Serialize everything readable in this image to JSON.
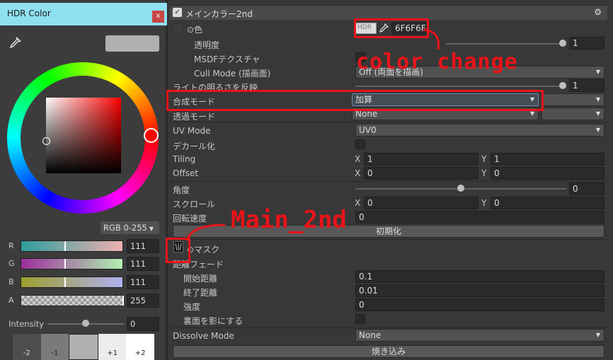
{
  "hdr_window": {
    "title": "HDR Color",
    "close_label": "x",
    "color_mode": "RGB 0-255",
    "channels": [
      {
        "label": "R",
        "value": "111",
        "fraction": 0.435
      },
      {
        "label": "G",
        "value": "111",
        "fraction": 0.435
      },
      {
        "label": "B",
        "value": "111",
        "fraction": 0.435
      },
      {
        "label": "A",
        "value": "255",
        "fraction": 1.0
      }
    ],
    "intensity_label": "Intensity",
    "intensity_value": "0",
    "presets": [
      "-2",
      "-1",
      "",
      "+1",
      "+2"
    ]
  },
  "inspector": {
    "section_title": "メインカラー2nd",
    "color_label": "色",
    "hdr_tag": "HDR",
    "hex_value": "6F6F6F",
    "transparency_label": "透明度",
    "transparency_value": "1",
    "msdf_label": "MSDFテクスチャ",
    "cull_label": "Cull Mode (描画面)",
    "cull_value": "Off (両面を描画)",
    "light_label": "ライトの明るさを反映",
    "light_value": "1",
    "blend_label": "合成モード",
    "blend_value": "加算",
    "trans_mode_label": "透過モード",
    "trans_mode_value": "None",
    "uv_label": "UV Mode",
    "uv_value": "UV0",
    "decal_label": "デカール化",
    "tiling_label": "Tiling",
    "tiling_x": "1",
    "tiling_y": "1",
    "offset_label": "Offset",
    "offset_x": "0",
    "offset_y": "0",
    "angle_label": "角度",
    "angle_value": "0",
    "scroll_label": "スクロール",
    "scroll_x": "0",
    "scroll_y": "0",
    "rot_speed_label": "回転速度",
    "rot_speed_value": "0",
    "init_button": "初期化",
    "mask_label": "マスク",
    "dist_fade_label": "距離フェード",
    "start_dist_label": "開始距離",
    "start_dist_value": "0.1",
    "end_dist_label": "終了距離",
    "end_dist_value": "0.01",
    "strength_label": "強度",
    "strength_value": "0",
    "backface_label": "裏面を影にする",
    "dissolve_label": "Dissolve Mode",
    "dissolve_value": "None",
    "bake_button": "焼き込み",
    "axis_x": "X",
    "axis_y": "Y"
  },
  "annotations": {
    "color_change": "color change",
    "main_2nd": "Main_2nd"
  },
  "colors": {
    "annotation_red": "#e8141a",
    "titlebar_cyan": "#8fe0f0",
    "swatch_gray": "#6F6F6F"
  }
}
